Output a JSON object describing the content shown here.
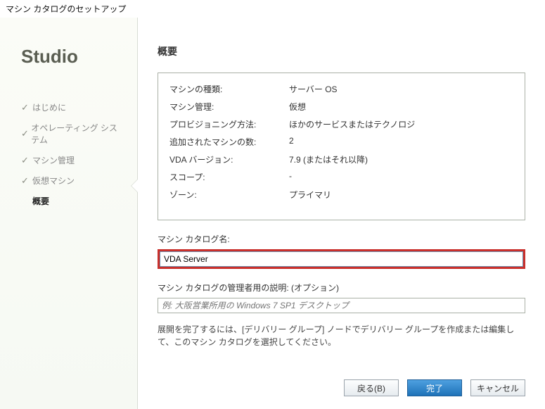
{
  "window": {
    "title": "マシン カタログのセットアップ"
  },
  "brand": "Studio",
  "nav": {
    "items": [
      {
        "label": "はじめに"
      },
      {
        "label": "オペレーティング システム"
      },
      {
        "label": "マシン管理"
      },
      {
        "label": "仮想マシン"
      },
      {
        "label": "概要"
      }
    ]
  },
  "main": {
    "title": "概要",
    "summary": [
      {
        "label": "マシンの種類:",
        "value": "サーバー OS"
      },
      {
        "label": "マシン管理:",
        "value": "仮想"
      },
      {
        "label": "プロビジョニング方法:",
        "value": "ほかのサービスまたはテクノロジ"
      },
      {
        "label": "追加されたマシンの数:",
        "value": "2"
      },
      {
        "label": "VDA バージョン:",
        "value": "7.9 (またはそれ以降)"
      },
      {
        "label": "スコープ:",
        "value": "-"
      },
      {
        "label": "ゾーン:",
        "value": "プライマリ"
      }
    ],
    "catalog_name_label": "マシン カタログ名:",
    "catalog_name_value": "VDA Server",
    "admin_desc_label": "マシン カタログの管理者用の説明: (オプション)",
    "admin_desc_placeholder": "例: 大阪営業所用の Windows 7 SP1 デスクトップ",
    "footnote": "展開を完了するには、[デリバリー グループ] ノードでデリバリー グループを作成または編集して、このマシン カタログを選択してください。"
  },
  "buttons": {
    "back": "戻る(B)",
    "finish": "完了",
    "cancel": "キャンセル"
  }
}
